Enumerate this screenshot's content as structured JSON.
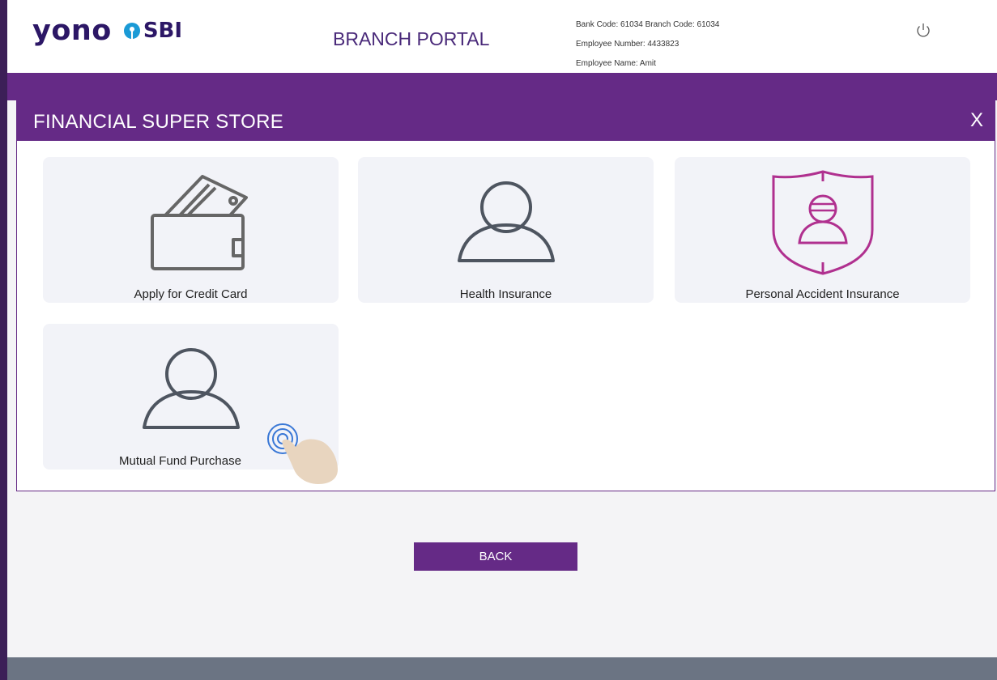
{
  "header": {
    "logo_yono": "yono",
    "logo_sbi": "SBI",
    "portal_title": "BRANCH PORTAL",
    "bank_code_line": "Bank Code: 61034 Branch Code: 61034",
    "employee_number_line": "Employee Number: 4433823",
    "employee_name_line": "Employee Name: Amit",
    "power_icon": "power-icon"
  },
  "modal": {
    "title": "FINANCIAL SUPER STORE",
    "close_label": "X",
    "tiles": [
      {
        "label": "Apply for Credit Card",
        "icon": "wallet-card-icon"
      },
      {
        "label": "Health Insurance",
        "icon": "user-icon"
      },
      {
        "label": "Personal Accident Insurance",
        "icon": "shield-user-icon"
      },
      {
        "label": "Mutual Fund Purchase",
        "icon": "user-icon"
      }
    ]
  },
  "actions": {
    "back_label": "BACK"
  },
  "colors": {
    "brand_purple": "#652a86",
    "logo_navy": "#2c1766",
    "shield_magenta": "#b0308f",
    "icon_gray": "#4e5560"
  }
}
